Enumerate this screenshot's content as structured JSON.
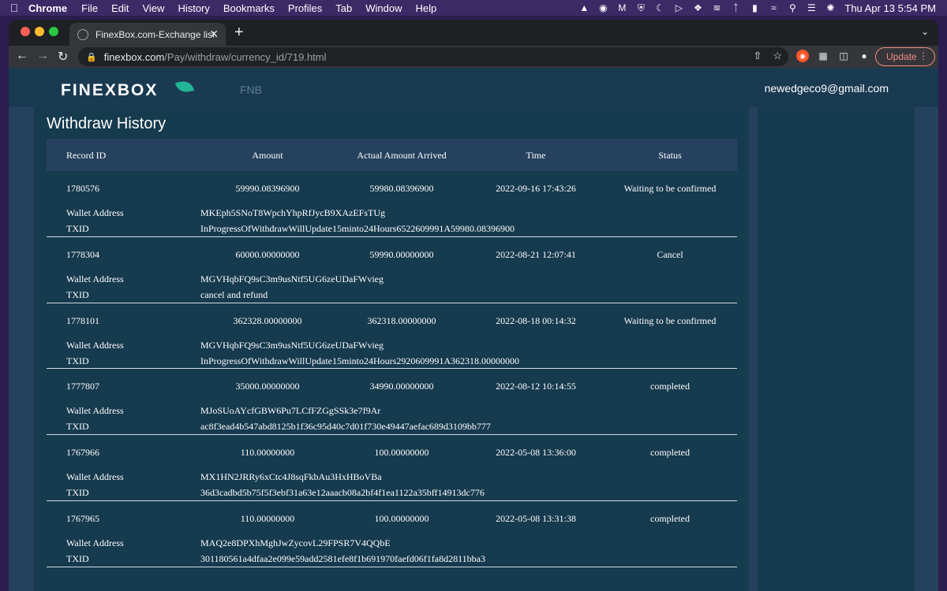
{
  "menubar": {
    "app": "Chrome",
    "items": [
      "File",
      "Edit",
      "View",
      "History",
      "Bookmarks",
      "Profiles",
      "Tab",
      "Window",
      "Help"
    ],
    "clock": "Thu Apr 13  5:54 PM"
  },
  "browser": {
    "tab_title": "FinexBox.com-Exchange list co",
    "url_host": "finexbox.com",
    "url_path": "/Pay/withdraw/currency_id/719.html",
    "update_label": "Update"
  },
  "site": {
    "logo": "FINEXBOX",
    "coin": "FNB",
    "user_email": "newedgeco9@gmail.com"
  },
  "withdraw": {
    "title": "Withdraw History",
    "columns": [
      "Record ID",
      "Amount",
      "Actual Amount Arrived",
      "Time",
      "Status"
    ],
    "wallet_label": "Wallet Address",
    "txid_label": "TXID",
    "records": [
      {
        "id": "1780576",
        "amount": "59990.08396900",
        "actual": "59980.08396900",
        "time": "2022-09-16 17:43:26",
        "status": "Waiting to be confirmed",
        "wallet": "MKEph5SNoT8WpchYhpRfJycB9XAzEFsTUg",
        "txid": "InProgressOfWithdrawWillUpdate15minto24Hours6522609991A59980.08396900"
      },
      {
        "id": "1778304",
        "amount": "60000.00000000",
        "actual": "59990.00000000",
        "time": "2022-08-21 12:07:41",
        "status": "Cancel",
        "wallet": "MGVHqbFQ9sC3m9usNtf5UG6zeUDaFWvieg",
        "txid": "cancel and refund"
      },
      {
        "id": "1778101",
        "amount": "362328.00000000",
        "actual": "362318.00000000",
        "time": "2022-08-18 00:14:32",
        "status": "Waiting to be confirmed",
        "wallet": "MGVHqbFQ9sC3m9usNtf5UG6zeUDaFWvieg",
        "txid": "InProgressOfWithdrawWillUpdate15minto24Hours2920609991A362318.00000000"
      },
      {
        "id": "1777807",
        "amount": "35000.00000000",
        "actual": "34990.00000000",
        "time": "2022-08-12 10:14:55",
        "status": "completed",
        "wallet": "MJoSUoAYcfGBW6Pu7LCfFZGgSSk3e7f9Ar",
        "txid": "ac8f3ead4b547abd8125b1f36c95d40c7d01f730e49447aefac689d3109bb777"
      },
      {
        "id": "1767966",
        "amount": "110.00000000",
        "actual": "100.00000000",
        "time": "2022-05-08 13:36:00",
        "status": "completed",
        "wallet": "MX1HN2JRRy6xCtc4J8sqFkbAu3HxHBoVBa",
        "txid": "36d3cadbd5b75f5f3ebf31a63e12aaacb08a2bf4f1ea1122a35bff14913dc776"
      },
      {
        "id": "1767965",
        "amount": "110.00000000",
        "actual": "100.00000000",
        "time": "2022-05-08 13:31:38",
        "status": "completed",
        "wallet": "MAQ2e8DPXhMghJwZycovL29FPSR7V4QQbE",
        "txid": "301180561a4dfaa2e099e59add2581efe8f1b691970faefd06f1fa8d2811bba3"
      }
    ]
  },
  "colors": {
    "page_bg": "#26415e",
    "panel_bg": "#163a4e",
    "brand_leaf": "#22b496",
    "update_accent": "#f28b82"
  }
}
